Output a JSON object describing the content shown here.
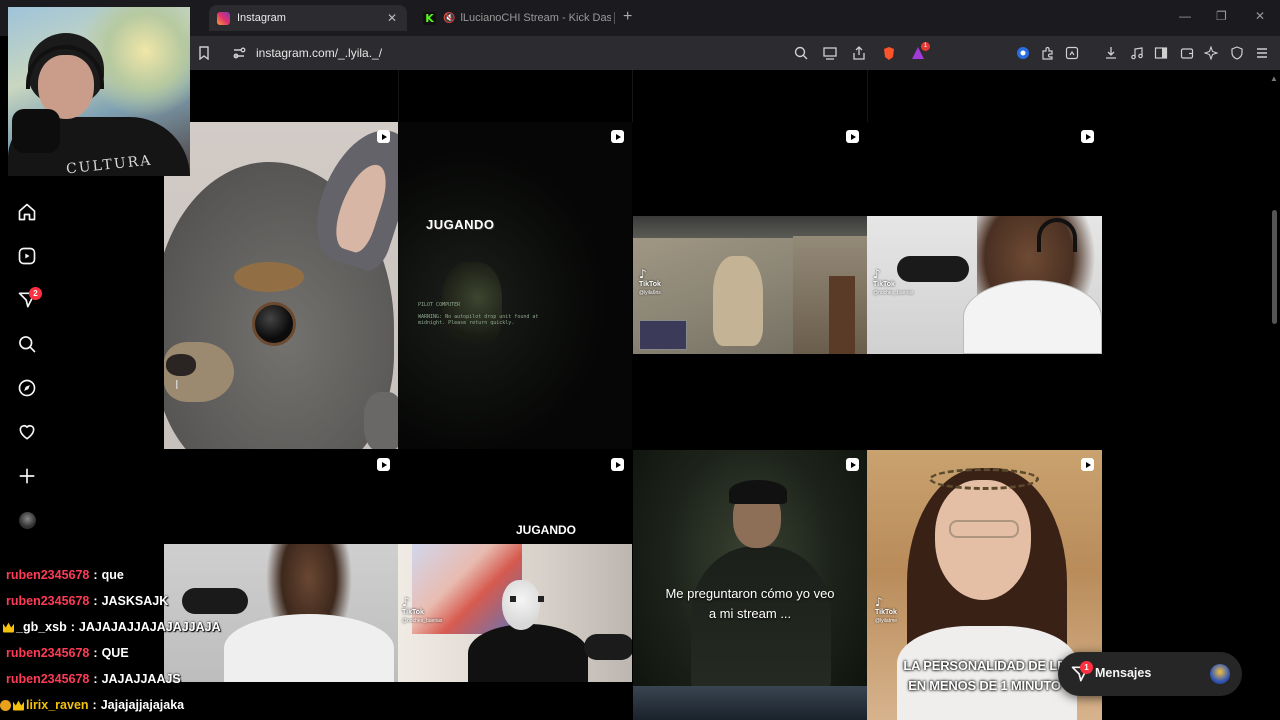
{
  "browser": {
    "tabs": [
      {
        "title": "Instagram",
        "active": true
      },
      {
        "title": "lLucianoCHI Stream - Kick Dashb",
        "active": false
      }
    ],
    "address": "instagram.com/_.lyila._/",
    "window_controls": [
      "minimize",
      "restore",
      "close"
    ],
    "extension_badge": "1"
  },
  "sidebar": {
    "items": [
      {
        "name": "home",
        "icon": "home-icon"
      },
      {
        "name": "reels",
        "icon": "reels-icon"
      },
      {
        "name": "messages",
        "icon": "messenger-icon",
        "badge": "2"
      },
      {
        "name": "search",
        "icon": "search-icon"
      },
      {
        "name": "explore",
        "icon": "compass-icon"
      },
      {
        "name": "notifications",
        "icon": "heart-icon"
      },
      {
        "name": "create",
        "icon": "plus-icon"
      },
      {
        "name": "profile",
        "icon": "avatar"
      }
    ]
  },
  "grid": {
    "posts": [
      {
        "type": "reel",
        "title": ""
      },
      {
        "type": "reel",
        "title": "JUGANDO",
        "text1": "PILOT COMPUTER",
        "text2": "WARNING: No autopilot drop unit found at midnight. Please return quickly."
      },
      {
        "type": "reel",
        "title": "",
        "tiktok": "TikTok",
        "tiktok_user": "@lyila6ris"
      },
      {
        "type": "reel",
        "title": "",
        "tiktok": "TikTok",
        "tiktok_user": "@noches_buenas"
      },
      {
        "type": "reel",
        "title": ""
      },
      {
        "type": "reel",
        "title": "JUGANDO",
        "tiktok": "TikTok",
        "tiktok_user": "@noches_buenas"
      },
      {
        "type": "reel",
        "caption_line1": "Me preguntaron cómo yo veo",
        "caption_line2": "a mi stream ..."
      },
      {
        "type": "reel",
        "caption_line1": "LA PERSONALIDAD DE LE",
        "caption_line2": "EN MENOS DE 1 MINUTO",
        "tiktok": "TikTok",
        "tiktok_user": "@lyilatme"
      }
    ]
  },
  "chat": {
    "messages": [
      {
        "user": "ruben2345678",
        "text": "que",
        "color": "#ff3b55"
      },
      {
        "user": "ruben2345678",
        "text": "JASKSAJK",
        "color": "#ff3b55"
      },
      {
        "user": "_gb_xsb",
        "text": "JAJAJAJJAJAJAJJAJA",
        "color": "#ffffff",
        "badge": "crown"
      },
      {
        "user": "ruben2345678",
        "text": "QUE",
        "color": "#ff3b55"
      },
      {
        "user": "ruben2345678",
        "text": "JAJAJJAAJS",
        "color": "#ff3b55"
      },
      {
        "user": "lirix_raven",
        "text": "Jajajajjajajaka",
        "color": "#f4c20d",
        "badge": "circle"
      }
    ]
  },
  "messages_pill": {
    "label": "Mensajes",
    "badge": "1"
  },
  "webcam": {
    "shirt_text": "CULTURA"
  },
  "colors": {
    "accent_red": "#ff3040",
    "chrome_bg": "#2b2b30",
    "tabbar_bg": "#1b1b1f"
  }
}
